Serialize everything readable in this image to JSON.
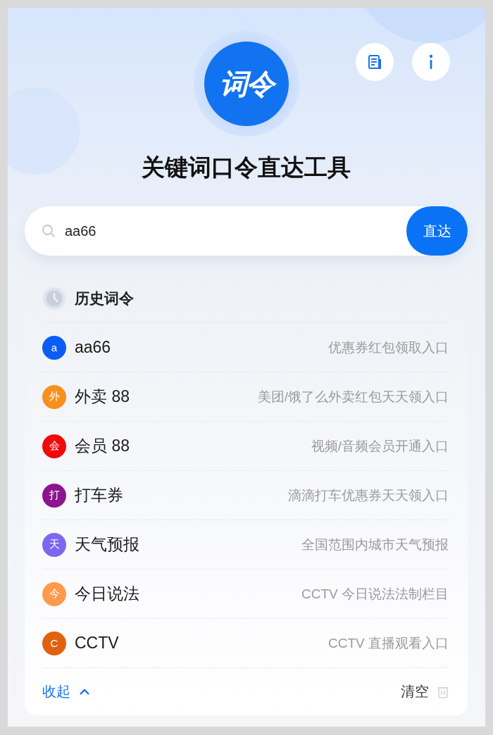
{
  "logo": {
    "text": "词令"
  },
  "title": "关键词口令直达工具",
  "search": {
    "value": "aa66",
    "button": "直达"
  },
  "history": {
    "heading": "历史词令",
    "items": [
      {
        "avatar": "a",
        "name": "aa66",
        "description": "优惠券红包领取入口",
        "color": "#0a5cf5"
      },
      {
        "avatar": "外",
        "name": "外卖 88",
        "description": "美团/饿了么外卖红包天天领入口",
        "color": "#f7901e"
      },
      {
        "avatar": "会",
        "name": "会员 88",
        "description": "视频/音频会员开通入口",
        "color": "#f00a0a"
      },
      {
        "avatar": "打",
        "name": "打车券",
        "description": "滴滴打车优惠券天天领入口",
        "color": "#8c158f"
      },
      {
        "avatar": "天",
        "name": "天气预报",
        "description": "全国范围内城市天气预报",
        "color": "#7b68ee"
      },
      {
        "avatar": "今",
        "name": "今日说法",
        "description": "CCTV 今日说法法制栏目",
        "color": "#ff9a4d"
      },
      {
        "avatar": "C",
        "name": "CCTV",
        "description": "CCTV 直播观看入口",
        "color": "#e0610e"
      }
    ],
    "collapse": "收起",
    "clear": "清空"
  }
}
